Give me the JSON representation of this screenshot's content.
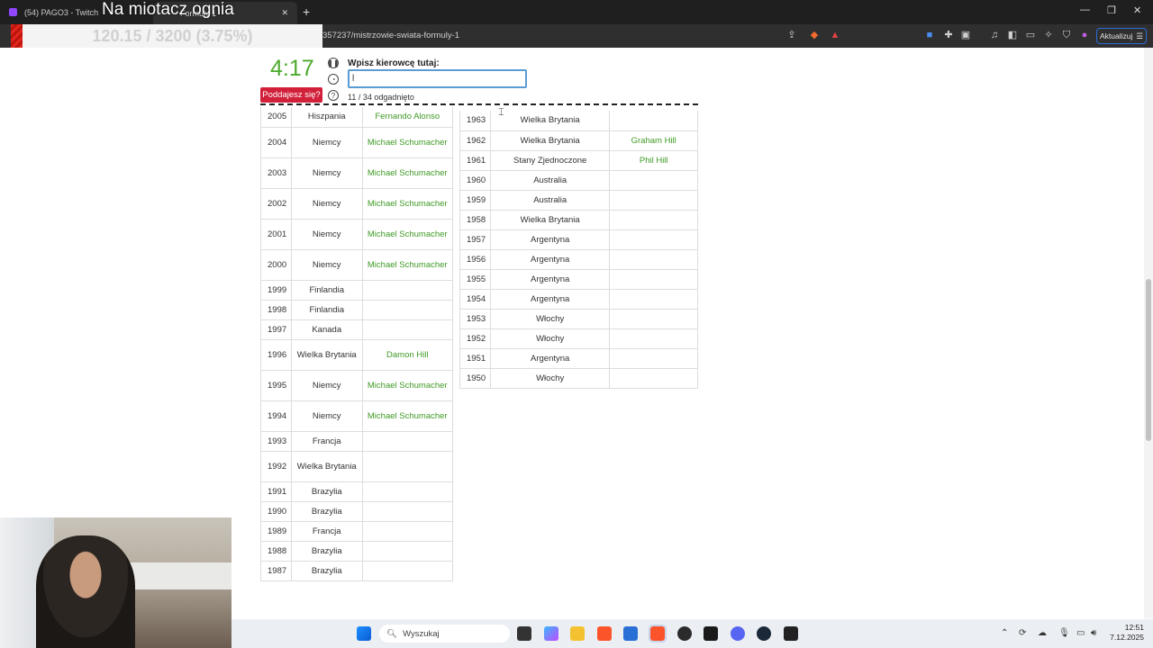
{
  "browser": {
    "tab1_title": "(54) PAGO3 - Twitch",
    "tab2_title": "Formuły 1",
    "url": "357237/mistrzowie-swiata-formuly-1",
    "update_label": "Aktualizuj"
  },
  "stream_overlay": {
    "title": "Na miotacz ognia",
    "counter": "120.15 / 3200 (3.75%)"
  },
  "quiz": {
    "timer": "4:17",
    "give_up_label": "Poddajesz się?",
    "prompt": "Wpisz kierowcę tutaj:",
    "answer_value": "l",
    "progress": "11 / 34 odgadnięto"
  },
  "table_left": [
    {
      "year": "2005",
      "country": "Hiszpania",
      "driver": "Fernando Alonso"
    },
    {
      "year": "2004",
      "country": "Niemcy",
      "driver": "Michael Schumacher"
    },
    {
      "year": "2003",
      "country": "Niemcy",
      "driver": "Michael Schumacher"
    },
    {
      "year": "2002",
      "country": "Niemcy",
      "driver": "Michael Schumacher"
    },
    {
      "year": "2001",
      "country": "Niemcy",
      "driver": "Michael Schumacher"
    },
    {
      "year": "2000",
      "country": "Niemcy",
      "driver": "Michael Schumacher"
    },
    {
      "year": "1999",
      "country": "Finlandia",
      "driver": ""
    },
    {
      "year": "1998",
      "country": "Finlandia",
      "driver": ""
    },
    {
      "year": "1997",
      "country": "Kanada",
      "driver": ""
    },
    {
      "year": "1996",
      "country": "Wielka Brytania",
      "driver": "Damon Hill"
    },
    {
      "year": "1995",
      "country": "Niemcy",
      "driver": "Michael Schumacher"
    },
    {
      "year": "1994",
      "country": "Niemcy",
      "driver": "Michael Schumacher"
    },
    {
      "year": "1993",
      "country": "Francja",
      "driver": ""
    },
    {
      "year": "1992",
      "country": "Wielka Brytania",
      "driver": ""
    },
    {
      "year": "1991",
      "country": "Brazylia",
      "driver": ""
    },
    {
      "year": "1990",
      "country": "Brazylia",
      "driver": ""
    },
    {
      "year": "1989",
      "country": "Francja",
      "driver": ""
    },
    {
      "year": "1988",
      "country": "Brazylia",
      "driver": ""
    },
    {
      "year": "1987",
      "country": "Brazylia",
      "driver": ""
    }
  ],
  "table_right": [
    {
      "year": "1963",
      "country": "Wielka Brytania",
      "driver": ""
    },
    {
      "year": "1962",
      "country": "Wielka Brytania",
      "driver": "Graham Hill"
    },
    {
      "year": "1961",
      "country": "Stany Zjednoczone",
      "driver": "Phil Hill"
    },
    {
      "year": "1960",
      "country": "Australia",
      "driver": ""
    },
    {
      "year": "1959",
      "country": "Australia",
      "driver": ""
    },
    {
      "year": "1958",
      "country": "Wielka Brytania",
      "driver": ""
    },
    {
      "year": "1957",
      "country": "Argentyna",
      "driver": ""
    },
    {
      "year": "1956",
      "country": "Argentyna",
      "driver": ""
    },
    {
      "year": "1955",
      "country": "Argentyna",
      "driver": ""
    },
    {
      "year": "1954",
      "country": "Argentyna",
      "driver": ""
    },
    {
      "year": "1953",
      "country": "Włochy",
      "driver": ""
    },
    {
      "year": "1952",
      "country": "Włochy",
      "driver": ""
    },
    {
      "year": "1951",
      "country": "Argentyna",
      "driver": ""
    },
    {
      "year": "1950",
      "country": "Włochy",
      "driver": ""
    }
  ],
  "taskbar": {
    "search_placeholder": "Wyszukaj",
    "time": "12:51",
    "date": "7.12.2025"
  },
  "colors": {
    "accent_green": "#3f9a25",
    "give_up_red": "#d2203a",
    "input_border": "#5b9bd5"
  }
}
